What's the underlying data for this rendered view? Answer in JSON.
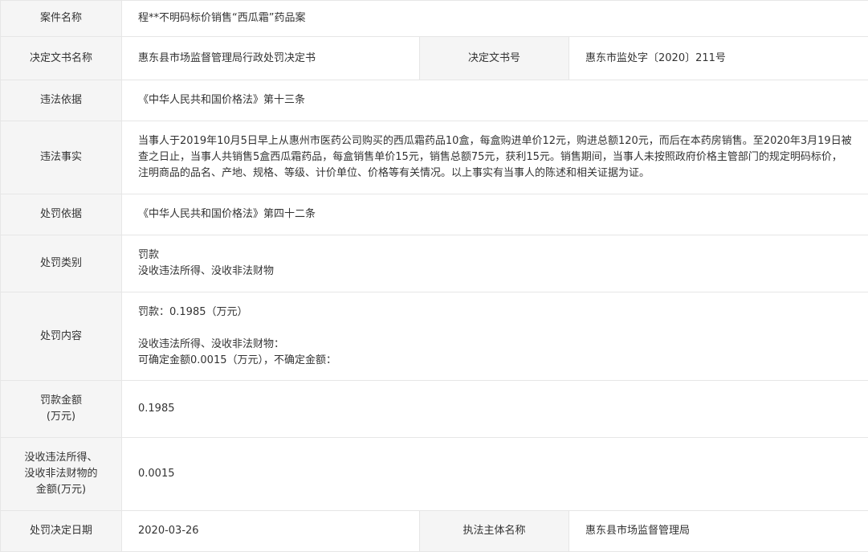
{
  "rows": {
    "case_name": {
      "label": "案件名称",
      "value": "程**不明码标价销售“西瓜霜”药品案"
    },
    "decision_doc": {
      "label": "决定文书名称",
      "value": "惠东县市场监督管理局行政处罚决定书",
      "label2": "决定文书号",
      "value2": "惠东市监处字〔2020〕211号"
    },
    "violation_basis": {
      "label": "违法依据",
      "value": "《中华人民共和国价格法》第十三条"
    },
    "violation_facts": {
      "label": "违法事实",
      "value": "当事人于2019年10月5日早上从惠州市医药公司购买的西瓜霜药品10盒，每盒购进单价12元，购进总额120元，而后在本药房销售。至2020年3月19日被查之日止，当事人共销售5盒西瓜霜药品，每盒销售单价15元，销售总额75元，获利15元。销售期间，当事人未按照政府价格主管部门的规定明码标价，注明商品的品名、产地、规格、等级、计价单位、价格等有关情况。以上事实有当事人的陈述和相关证据为证。"
    },
    "penalty_basis": {
      "label": "处罚依据",
      "value": "《中华人民共和国价格法》第四十二条"
    },
    "penalty_type": {
      "label": "处罚类别",
      "line1": "罚款",
      "line2": "没收违法所得、没收非法财物"
    },
    "penalty_content": {
      "label": "处罚内容",
      "line1": "罚款：0.1985（万元）",
      "line2": "没收违法所得、没收非法财物：",
      "line3": "可确定金额0.0015（万元），不确定金额："
    },
    "fine_amount": {
      "label_line1": "罚款金额",
      "label_line2": "(万元)",
      "value": "0.1985"
    },
    "confiscation_amount": {
      "label_line1": "没收违法所得、",
      "label_line2": "没收非法财物的",
      "label_line3": "金额(万元)",
      "value": "0.0015"
    },
    "decision_date": {
      "label": "处罚决定日期",
      "value": "2020-03-26",
      "label2": "执法主体名称",
      "value2": "惠东县市场监督管理局"
    }
  }
}
